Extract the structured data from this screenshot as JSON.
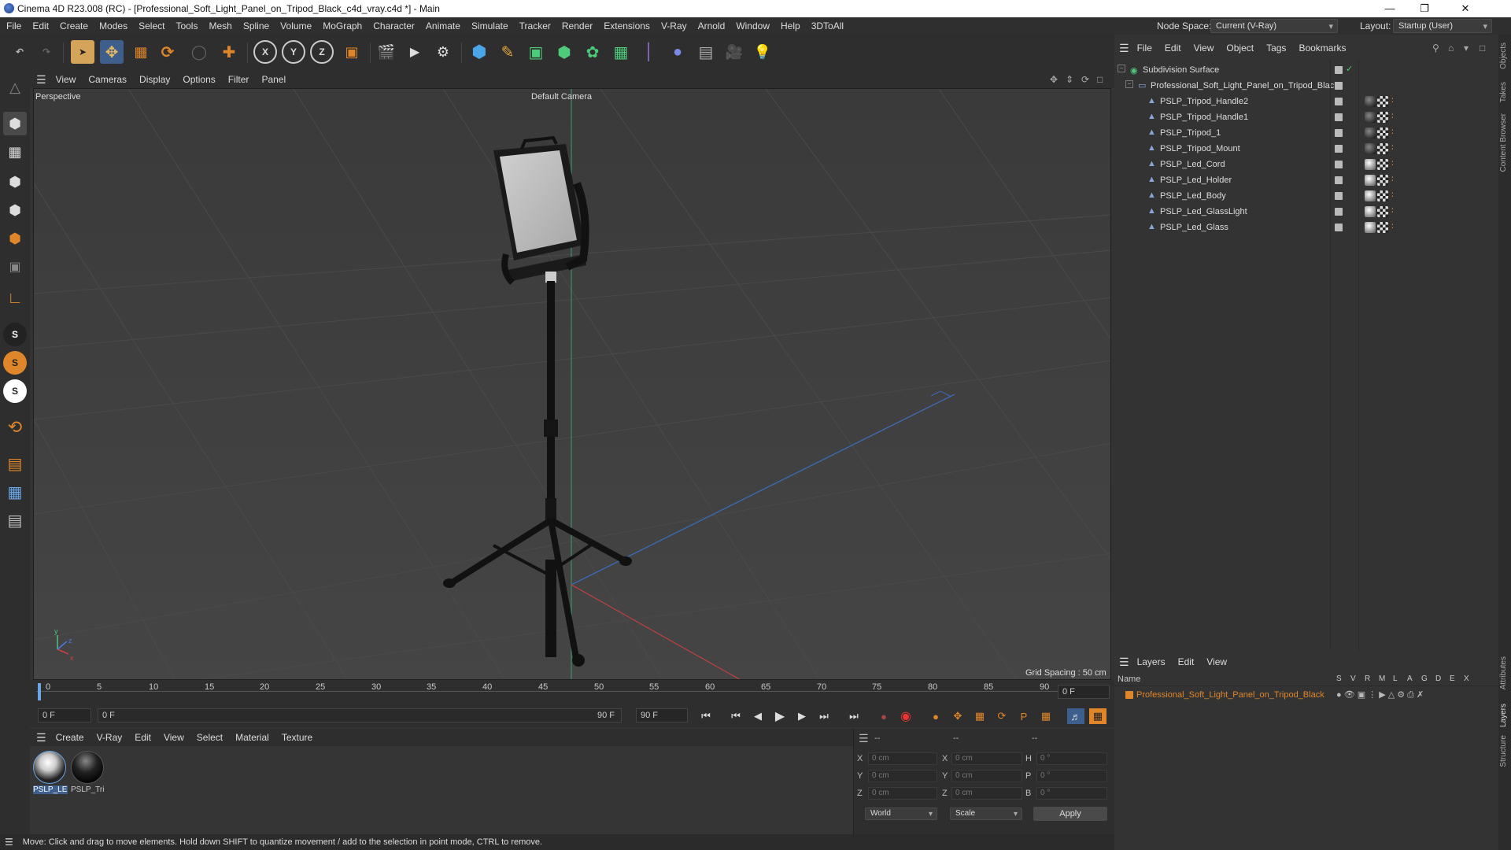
{
  "window": {
    "title": "Cinema 4D R23.008 (RC) - [Professional_Soft_Light_Panel_on_Tripod_Black_c4d_vray.c4d *] - Main"
  },
  "menu": [
    "File",
    "Edit",
    "Create",
    "Modes",
    "Select",
    "Tools",
    "Mesh",
    "Spline",
    "Volume",
    "MoGraph",
    "Character",
    "Animate",
    "Simulate",
    "Tracker",
    "Render",
    "Extensions",
    "V-Ray",
    "Arnold",
    "Window",
    "Help",
    "3DToAll"
  ],
  "node_space": {
    "label": "Node Space:",
    "value": "Current (V-Ray)"
  },
  "layout": {
    "label": "Layout:",
    "value": "Startup (User)"
  },
  "viewport": {
    "menu": [
      "View",
      "Cameras",
      "Display",
      "Options",
      "Filter",
      "Panel"
    ],
    "name": "Perspective",
    "camera": "Default Camera",
    "grid_spacing": "Grid Spacing : 50 cm"
  },
  "timeline": {
    "ticks": [
      "0",
      "5",
      "10",
      "15",
      "20",
      "25",
      "30",
      "35",
      "40",
      "45",
      "50",
      "55",
      "60",
      "65",
      "70",
      "75",
      "80",
      "85",
      "90"
    ],
    "current": "0 F"
  },
  "transport": {
    "start": "0 F",
    "range_start": "0 F",
    "range_end": "90 F",
    "end": "90 F"
  },
  "material_menu": [
    "Create",
    "V-Ray",
    "Edit",
    "View",
    "Select",
    "Material",
    "Texture"
  ],
  "materials": [
    {
      "name": "PSLP_LE"
    },
    {
      "name": "PSLP_Tri"
    }
  ],
  "coords": {
    "header": [
      "--",
      "--",
      "--"
    ],
    "x": "0 cm",
    "y": "0 cm",
    "z": "0 cm",
    "x2": "0 cm",
    "y2": "0 cm",
    "z2": "0 cm",
    "h": "0 °",
    "p": "0 °",
    "b": "0 °",
    "world": "World",
    "scale": "Scale",
    "apply": "Apply"
  },
  "status": "Move: Click and drag to move elements. Hold down SHIFT to quantize movement / add to the selection in point mode, CTRL to remove.",
  "objects_menu": [
    "File",
    "Edit",
    "View",
    "Object",
    "Tags",
    "Bookmarks"
  ],
  "objects": [
    {
      "name": "Subdivision Surface"
    },
    {
      "name": "Professional_Soft_Light_Panel_on_Tripod_Black"
    },
    {
      "name": "PSLP_Tripod_Handle2"
    },
    {
      "name": "PSLP_Tripod_Handle1"
    },
    {
      "name": "PSLP_Tripod_1"
    },
    {
      "name": "PSLP_Tripod_Mount"
    },
    {
      "name": "PSLP_Led_Cord"
    },
    {
      "name": "PSLP_Led_Holder"
    },
    {
      "name": "PSLP_Led_Body"
    },
    {
      "name": "PSLP_Led_GlassLight"
    },
    {
      "name": "PSLP_Led_Glass"
    }
  ],
  "layers_menu": [
    "Layers",
    "Edit",
    "View"
  ],
  "layers_header": {
    "name": "Name",
    "flags": [
      "S",
      "V",
      "R",
      "M",
      "L",
      "A",
      "G",
      "D",
      "E",
      "X"
    ]
  },
  "layers": [
    {
      "name": "Professional_Soft_Light_Panel_on_Tripod_Black",
      "color": "#e0862a"
    }
  ],
  "side_tabs": [
    "Objects",
    "Takes",
    "Content Browser",
    "Attributes",
    "Layers",
    "Structure"
  ],
  "colors": {
    "accent": "#e0862a",
    "bg": "#333333",
    "viewport": "#3f3f3f"
  }
}
